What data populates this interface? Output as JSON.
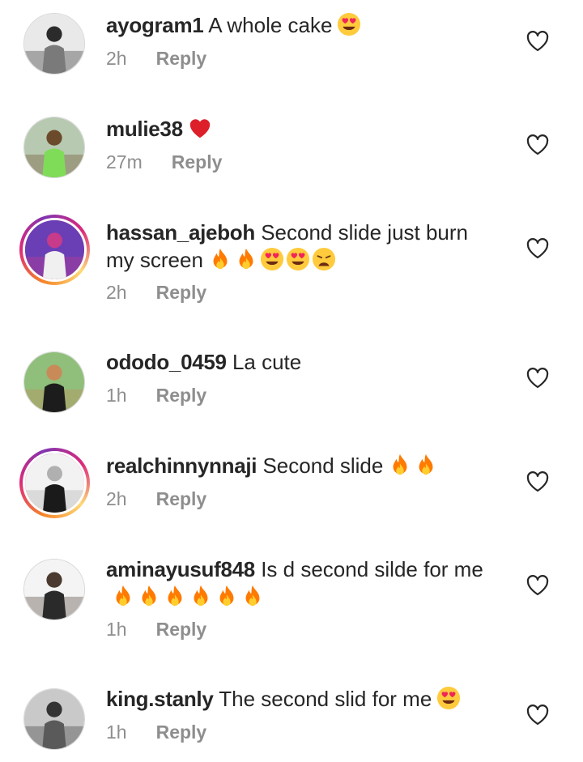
{
  "comments": [
    {
      "username": "ayogram1",
      "text": "A whole cake",
      "emojis": [
        "heart-eyes"
      ],
      "time": "2h",
      "reply_label": "Reply",
      "avatar_ring": false,
      "avatar_colors": [
        "#e9e9e9",
        "#7a7a7a",
        "#2b2b2b"
      ]
    },
    {
      "username": "mulie38",
      "text": "",
      "emojis": [
        "red-heart"
      ],
      "time": "27m",
      "reply_label": "Reply",
      "avatar_ring": false,
      "avatar_colors": [
        "#b7c9b0",
        "#7fdc58",
        "#6b4a2b"
      ]
    },
    {
      "username": "hassan_ajeboh",
      "text": "Second slide just burn my screen",
      "emojis": [
        "fire",
        "fire",
        "heart-eyes",
        "heart-eyes",
        "weary"
      ],
      "time": "2h",
      "reply_label": "Reply",
      "avatar_ring": true,
      "avatar_colors": [
        "#6a3fb5",
        "#f0f0f0",
        "#c83a8a"
      ]
    },
    {
      "username": "ododo_0459",
      "text": "La cute",
      "emojis": [],
      "time": "1h",
      "reply_label": "Reply",
      "avatar_ring": false,
      "avatar_colors": [
        "#8fbf7a",
        "#1c1c1c",
        "#c98a5a"
      ]
    },
    {
      "username": "realchinnynnaji",
      "text": "Second slide",
      "emojis": [
        "fire",
        "fire"
      ],
      "time": "2h",
      "reply_label": "Reply",
      "avatar_ring": true,
      "avatar_colors": [
        "#f2f2f2",
        "#1a1a1a",
        "#b0b0b0"
      ]
    },
    {
      "username": "aminayusuf848",
      "text": "Is d second silde for me",
      "emojis": [
        "fire",
        "fire",
        "fire",
        "fire",
        "fire",
        "fire"
      ],
      "time": "1h",
      "reply_label": "Reply",
      "avatar_ring": false,
      "avatar_colors": [
        "#f4f4f4",
        "#2a2a2a",
        "#4a3a30"
      ]
    },
    {
      "username": "king.stanly",
      "text": "The second slid for me",
      "emojis": [
        "heart-eyes"
      ],
      "time": "1h",
      "reply_label": "Reply",
      "avatar_ring": false,
      "avatar_colors": [
        "#c9c9c9",
        "#5a5a5a",
        "#333333"
      ]
    }
  ],
  "icons": {
    "like": "heart-outline-icon"
  },
  "colors": {
    "username": "#262626",
    "secondary": "#8e8e8e",
    "like_icon": "#262626"
  }
}
